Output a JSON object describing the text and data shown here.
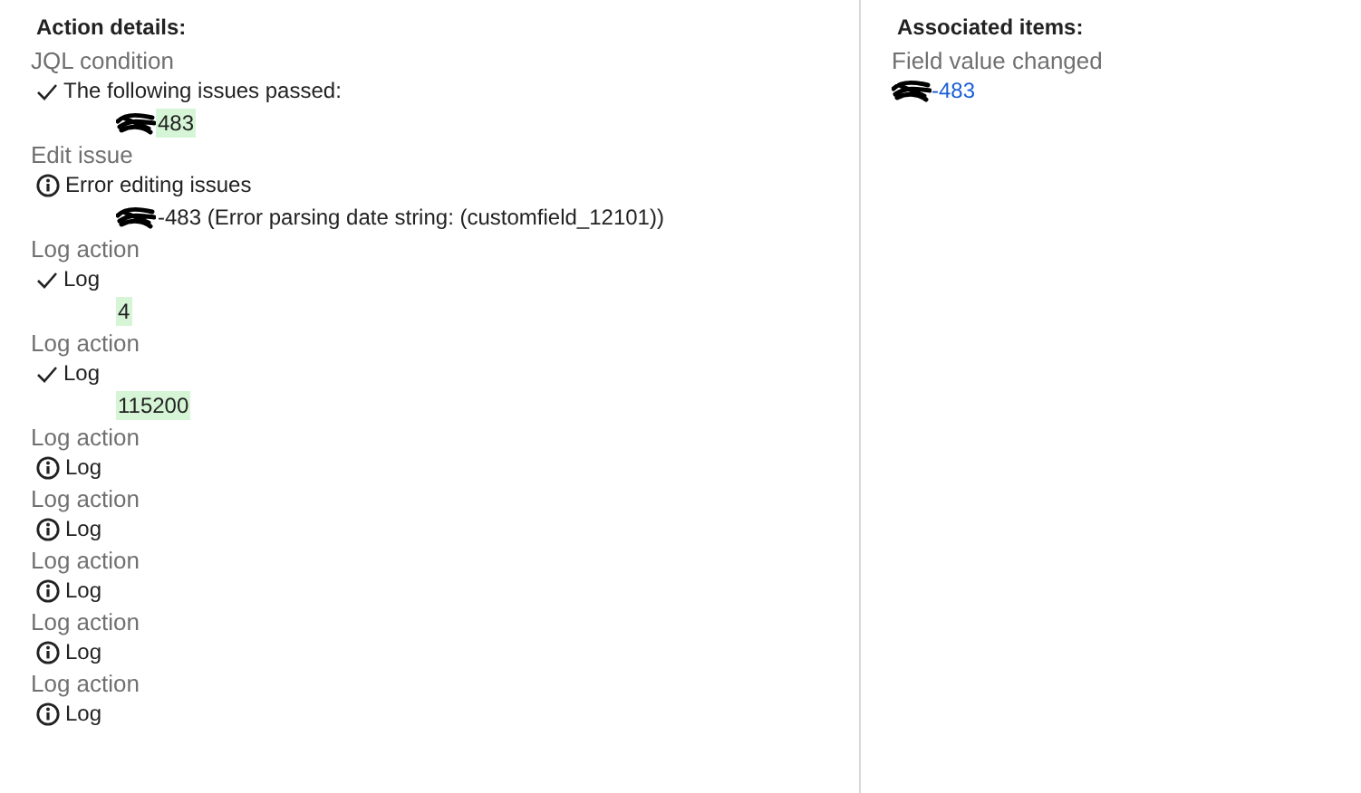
{
  "details": {
    "heading": "Action details:",
    "actions": [
      {
        "title": "JQL condition",
        "kind": "success",
        "message": "The following issues passed:",
        "details": [
          {
            "text": "483",
            "redacted": true,
            "highlighted": true
          }
        ]
      },
      {
        "title": "Edit issue",
        "kind": "info",
        "message": "Error editing issues",
        "details": [
          {
            "text": "-483 (Error parsing date string: (customfield_12101))",
            "redacted": true,
            "highlighted": false
          }
        ]
      },
      {
        "title": "Log action",
        "kind": "success",
        "message": "Log",
        "details": [
          {
            "text": "4",
            "redacted": false,
            "highlighted": true
          }
        ]
      },
      {
        "title": "Log action",
        "kind": "success",
        "message": "Log",
        "details": [
          {
            "text": "115200",
            "redacted": false,
            "highlighted": true
          }
        ]
      },
      {
        "title": "Log action",
        "kind": "info",
        "message": "Log"
      },
      {
        "title": "Log action",
        "kind": "info",
        "message": "Log"
      },
      {
        "title": "Log action",
        "kind": "info",
        "message": "Log"
      },
      {
        "title": "Log action",
        "kind": "info",
        "message": "Log"
      },
      {
        "title": "Log action",
        "kind": "info",
        "message": "Log"
      }
    ]
  },
  "associated": {
    "heading": "Associated items:",
    "items": [
      {
        "label": "Field value changed",
        "link": "-483",
        "redacted": true
      }
    ]
  }
}
